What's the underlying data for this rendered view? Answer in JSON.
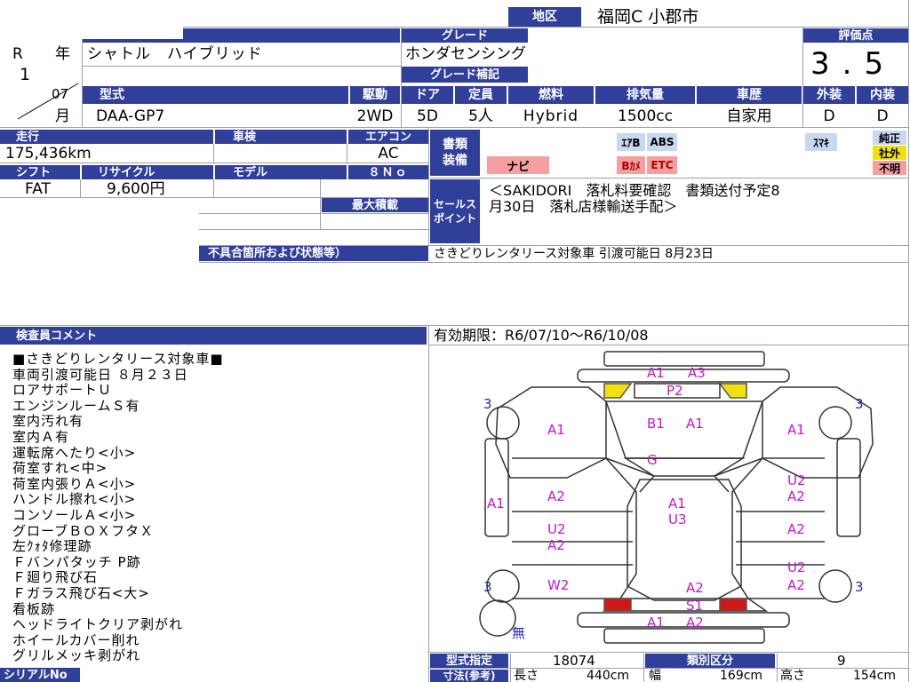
{
  "region": {
    "label": "地区",
    "value": "福岡C 小郡市"
  },
  "year": {
    "era": "R",
    "year_label": "年",
    "year": "1",
    "month": "07",
    "month_label": "月"
  },
  "car_name": "シャトル　ハイブリッド",
  "grade": {
    "label": "グレード",
    "value": "ホンダセンシング",
    "supplement_label": "グレード補記"
  },
  "score": {
    "label": "評価点",
    "value": "3.5"
  },
  "spec_headers": {
    "model": "型式",
    "drive": "駆動",
    "doors": "ドア",
    "capacity": "定員",
    "fuel": "燃料",
    "displacement": "排気量",
    "history": "車歴",
    "exterior": "外装",
    "interior": "内装"
  },
  "spec_values": {
    "model": "DAA-GP7",
    "drive": "2WD",
    "doors": "5D",
    "capacity": "5人",
    "fuel": "Hybrid",
    "displacement": "1500cc",
    "history": "自家用",
    "exterior": "D",
    "interior": "D"
  },
  "mileage": {
    "label": "走行",
    "value": "175,436km"
  },
  "inspection": {
    "label": "車検"
  },
  "aircon": {
    "label": "エアコン",
    "value": "AC"
  },
  "shift": {
    "label": "シフト",
    "value": "FAT"
  },
  "recycle": {
    "label": "リサイクル",
    "value": "9,600円"
  },
  "model_year": {
    "label": "モデル",
    "value": "８Ｎｏ"
  },
  "max_load": {
    "label": "最大積載"
  },
  "documents": {
    "label_1": "書類",
    "label_2": "装備"
  },
  "equipment": {
    "keyless": "ｽﾏｷ",
    "genuine": "純正",
    "aftermarket": "社外",
    "unknown": "不明",
    "navi": "ナビ",
    "airbag": "ｴｱB",
    "abs": "ABS",
    "bcamera": "Bｶﾒ",
    "etc": "ETC"
  },
  "sales_point": {
    "label_1": "セールス",
    "label_2": "ポイント",
    "text_1": "＜SAKIDORI　落札料要確認　書類送付予定8",
    "text_2": "月30日　落札店様輸送手配＞"
  },
  "defects": {
    "label": "不具合箇所および状態等）",
    "value": "さきどりレンタリース対象車 引渡可能日 8月23日"
  },
  "inspector": {
    "label": "検査員コメント"
  },
  "validity": "有効期限：R6/07/10～R6/10/08",
  "comments": [
    "■さきどりレンタリース対象車■",
    "車両引渡可能日 ８月２３日",
    "ロアサポートＵ",
    "エンジンルームＳ有",
    "室内汚れ有",
    "室内Ａ有",
    "運転席へたり<小>",
    "荷室すれ<中>",
    "荷室内張りＡ<小>",
    "ハンドル擦れ<小>",
    "コンソールＡ<小>",
    "グローブＢＯＸフタＸ",
    "左ｸｫﾀ修理跡",
    "Ｆバンパタッチ P跡",
    "Ｆ廻り飛び石",
    "Ｆガラス飛び石<大>",
    "看板跡",
    "ヘッドライトクリア剥がれ",
    "ホイールカバー削れ",
    "グリルメッキ剥がれ"
  ],
  "diagram_marks": {
    "front_a1": "A1",
    "front_a3": "A3",
    "front_p2": "P2",
    "hood_b1": "B1",
    "hood_a1": "A1",
    "glass_g": "G",
    "left_front_a1": "A1",
    "right_front_a1": "A1",
    "roof_a1": "A1",
    "roof_u3": "U3",
    "left_a1": "A1",
    "left_a2_1": "A2",
    "left_u2": "U2",
    "left_a2_2": "A2",
    "left_w2": "W2",
    "right_u2_1": "U2",
    "right_a2_1": "A2",
    "right_a2_2": "A2",
    "right_u2_2": "U2",
    "right_a2_3": "A2",
    "rear_a2": "A2",
    "rear_s1": "S1",
    "rear_a1": "A1",
    "rear_a2_2": "A2",
    "wheel_tl": "3",
    "wheel_tr": "3",
    "wheel_bl": "3",
    "wheel_br": "3",
    "spare": "無"
  },
  "type_designation": {
    "label": "型式指定",
    "value": "18074"
  },
  "category": {
    "label": "類別区分",
    "value": "9"
  },
  "dimensions": {
    "label": "寸法(参考)",
    "length_label": "長さ",
    "length": "440cm",
    "width_label": "幅",
    "width": "169cm",
    "height_label": "高さ",
    "height": "154cm"
  },
  "serial": {
    "label": "シリアルNo"
  },
  "colors": {
    "header_bg": "#2f3f9a",
    "damage": "#c019c6",
    "highlight_yellow": "#f0e010",
    "taillight_red": "#d01818",
    "navi_bg": "#f4a0a0",
    "equip_bg": "#c8d8f0"
  }
}
